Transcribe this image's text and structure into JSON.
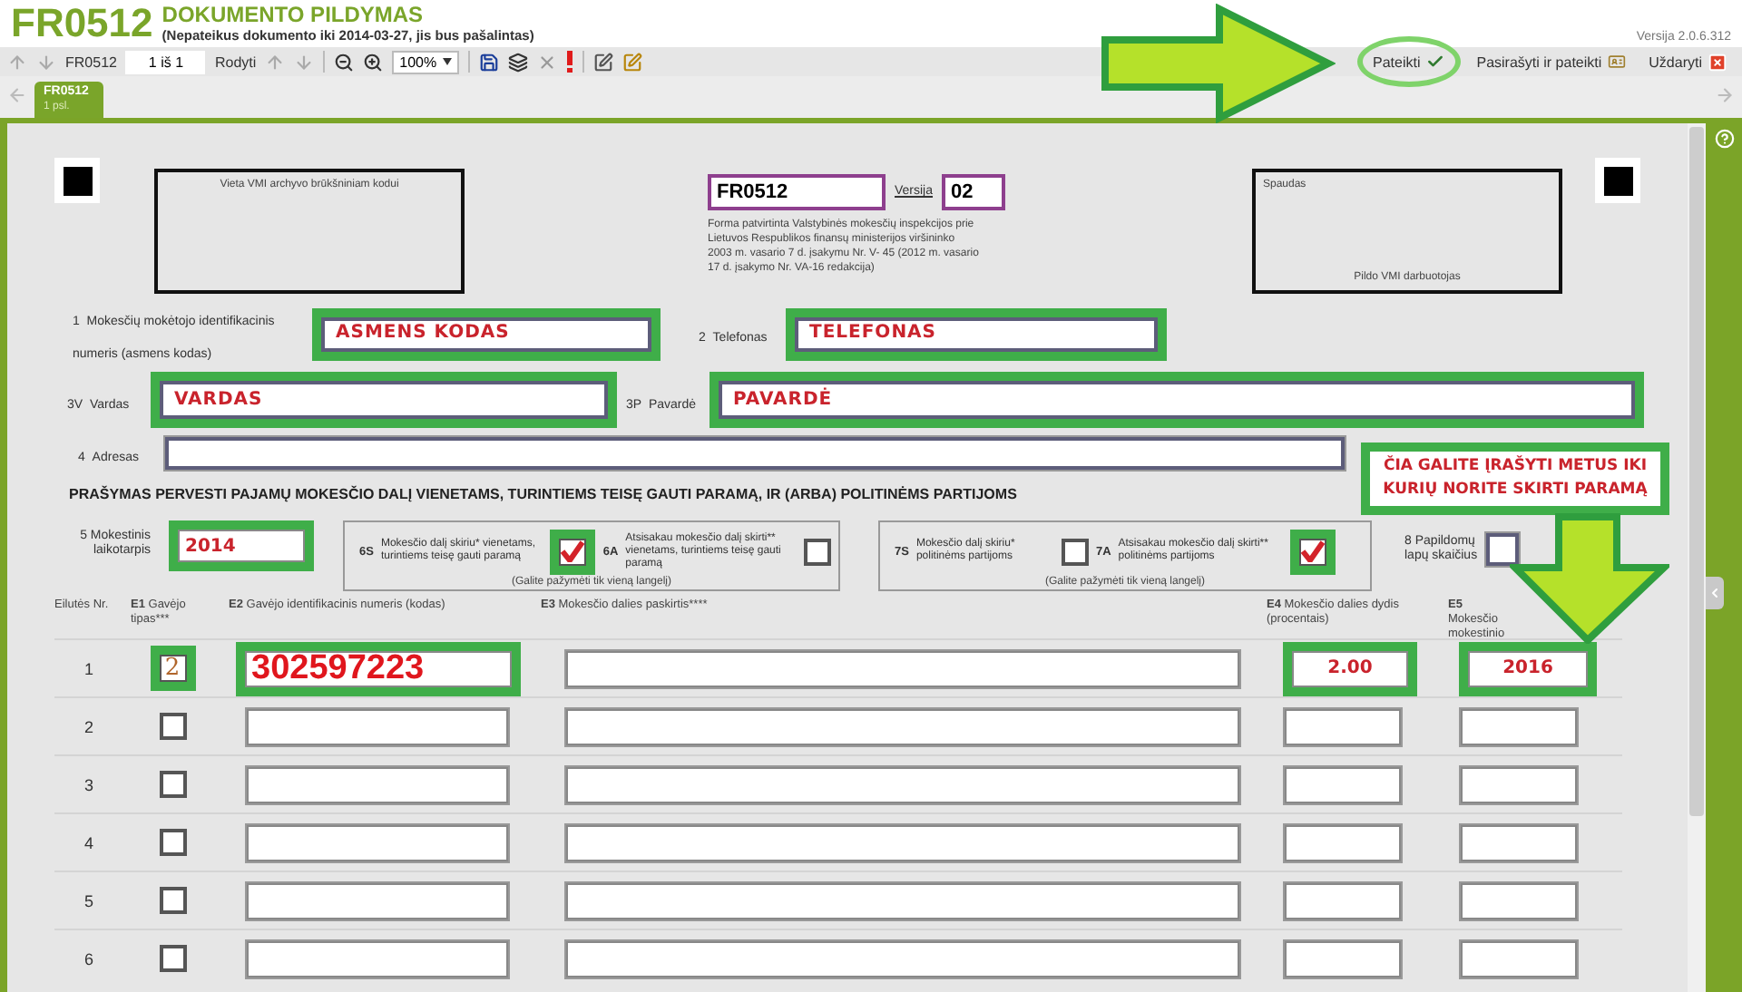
{
  "header": {
    "code": "FR0512",
    "title": "DOKUMENTO PILDYMAS",
    "notice": "(Nepateikus dokumento iki 2014-03-27, jis bus pašalintas)",
    "version": "Versija 2.0.6.312"
  },
  "toolbar": {
    "doc": "FR0512",
    "page": "1 iš 1",
    "show": "Rodyti",
    "zoom": "100%",
    "actions": [
      {
        "kind": "submit",
        "label": "Pateikti",
        "circled": true
      },
      {
        "kind": "sign",
        "label": "Pasirašyti ir pateikti",
        "circled": false
      },
      {
        "kind": "close",
        "label": "Uždaryti",
        "circled": false
      }
    ]
  },
  "tabs": [
    {
      "title": "FR0512",
      "subtitle": "1 psl.",
      "selected": true
    }
  ],
  "form": {
    "archive_label": "Vieta VMI archyvo brūkšniniam kodui",
    "form_code": "FR0512",
    "version_label": "Versija",
    "version": "02",
    "approval": "Forma patvirtinta Valstybinės mokesčių inspekcijos prie Lietuvos Respublikos finansų ministerijos viršininko 2003 m. vasario 7 d. įsakymu Nr. V- 45 (2012 m. vasario 17 d. įsakymo Nr. VA-16 redakcija)",
    "stamp_label": "Spaudas",
    "stamp_note": "Pildo VMI darbuotojas",
    "fields": [
      {
        "code": "1",
        "label": "Mokesčių mokėtojo identifikacinis numeris (asmens kodas)",
        "value": "ASMENS KODAS",
        "highlighted": true
      },
      {
        "code": "2",
        "label": "Telefonas",
        "value": "TELEFONAS",
        "highlighted": true
      },
      {
        "code": "3V",
        "label": "Vardas",
        "value": "VARDAS",
        "highlighted": true
      },
      {
        "code": "3P",
        "label": "Pavardė",
        "value": "PAVARDĖ",
        "highlighted": true
      },
      {
        "code": "4",
        "label": "Adresas",
        "highlighted": false
      }
    ],
    "heading": "PRAŠYMAS PERVESTI PAJAMŲ MOKESČIO DALĮ VIENETAMS, TURINTIEMS TEISĘ GAUTI PARAMĄ, IR (ARBA) POLITINĖMS PARTIJOMS",
    "period": {
      "code": "5",
      "label": "Mokestinis laikotarpis",
      "value": "2014",
      "highlighted": true
    },
    "groups": [
      {
        "note": "(Galite pažymėti tik vieną langelį)",
        "options": [
          {
            "code": "6S",
            "label": "Mokesčio dalį skiriu* vienetams, turintiems teisę gauti paramą",
            "checked": true,
            "highlighted": true
          },
          {
            "code": "6A",
            "label": "Atsisakau mokesčio dalį skirti** vienetams, turintiems teisę gauti paramą",
            "checked": false,
            "highlighted": false
          }
        ]
      },
      {
        "note": "(Galite pažymėti tik vieną langelį)",
        "options": [
          {
            "code": "7S",
            "label": "Mokesčio dalį skiriu* politinėms partijoms",
            "checked": false,
            "highlighted": false
          },
          {
            "code": "7A",
            "label": "Atsisakau mokesčio dalį skirti** politinėms partijoms",
            "checked": true,
            "highlighted": true
          }
        ]
      }
    ],
    "sheets": {
      "code": "8",
      "label": "Papildomų lapų skaičius"
    },
    "columns": [
      {
        "label": "Eilutės Nr."
      },
      {
        "code": "E1",
        "label": "Gavėjo tipas***"
      },
      {
        "code": "E2",
        "label": "Gavėjo identifikacinis numeris (kodas)"
      },
      {
        "code": "E3",
        "label": "Mokesčio dalies paskirtis****"
      },
      {
        "code": "E4",
        "label": "Mokesčio dalies dydis (procentais)"
      },
      {
        "code": "E5",
        "label": "Mokesčio",
        "label2": "mokestinio"
      }
    ],
    "rows": [
      {
        "no": "1",
        "type": "2",
        "id": "302597223",
        "percent": "2.00",
        "until": "2016",
        "highlighted": true
      },
      {
        "no": "2",
        "highlighted": false
      },
      {
        "no": "3",
        "highlighted": false
      },
      {
        "no": "4",
        "highlighted": false
      },
      {
        "no": "5",
        "highlighted": false
      },
      {
        "no": "6",
        "highlighted": false
      }
    ]
  },
  "annotations": {
    "note": "ČIA GALITE ĮRAŠYTI METUS IKI KURIŲ NORITE SKIRTI PARAMĄ"
  }
}
